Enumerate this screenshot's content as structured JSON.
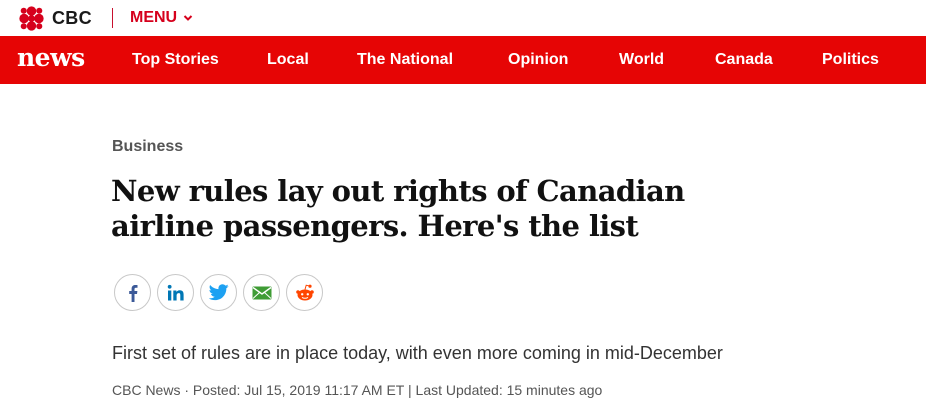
{
  "brand": {
    "name": "CBC",
    "menu_label": "MENU",
    "news_logo": "news",
    "colors": {
      "red": "#e60505",
      "text": "#1a1a1a"
    }
  },
  "nav": {
    "items": [
      {
        "label": "Top Stories"
      },
      {
        "label": "Local"
      },
      {
        "label": "The National"
      },
      {
        "label": "Opinion"
      },
      {
        "label": "World"
      },
      {
        "label": "Canada"
      },
      {
        "label": "Politics"
      }
    ]
  },
  "article": {
    "section": "Business",
    "headline": "New rules lay out rights of Canadian airline passengers. Here's the list",
    "deck": "First set of rules are in place today, with even more coming in mid-December",
    "byline": {
      "source": "CBC News",
      "posted": "Posted: Jul 15, 2019 11:17 AM ET",
      "updated": "Last Updated: 15 minutes ago",
      "separator_dot": "·",
      "separator_bar": "|"
    }
  },
  "share": {
    "buttons": [
      {
        "icon": "facebook-icon",
        "color": "#3b5998"
      },
      {
        "icon": "linkedin-icon",
        "color": "#0077b5"
      },
      {
        "icon": "twitter-icon",
        "color": "#1da1f2"
      },
      {
        "icon": "email-icon",
        "color": "#3f9c35"
      },
      {
        "icon": "reddit-icon",
        "color": "#ff4500"
      }
    ]
  }
}
